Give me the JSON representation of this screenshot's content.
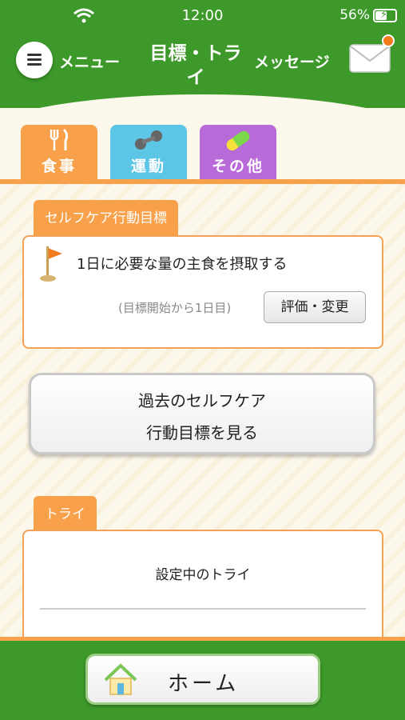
{
  "status_bar": {
    "time": "12:00",
    "battery": "56%"
  },
  "header": {
    "menu_label": "メニュー",
    "title": "目標・トライ",
    "message_label": "メッセージ"
  },
  "categories": [
    {
      "label": "食事",
      "icon": "fork-knife-icon",
      "color": "#f9a04a"
    },
    {
      "label": "運動",
      "icon": "dumbbell-icon",
      "color": "#5cc6e6"
    },
    {
      "label": "その他",
      "icon": "capsule-icon",
      "color": "#b86ad8"
    }
  ],
  "selfcare": {
    "section_label": "セルフケア行動目標",
    "goal": "1日に必要な量の主食を摂取する",
    "since": "(目標開始から1日目)",
    "evaluate_button": "評価・変更"
  },
  "past_goals_button": {
    "line1": "過去のセルフケア",
    "line2": "行動目標を見る"
  },
  "try": {
    "section_label": "トライ",
    "current": "設定中のトライ"
  },
  "home_button": "ホーム",
  "colors": {
    "header_green": "#3d9a2a",
    "accent_orange": "#f9a04a"
  }
}
